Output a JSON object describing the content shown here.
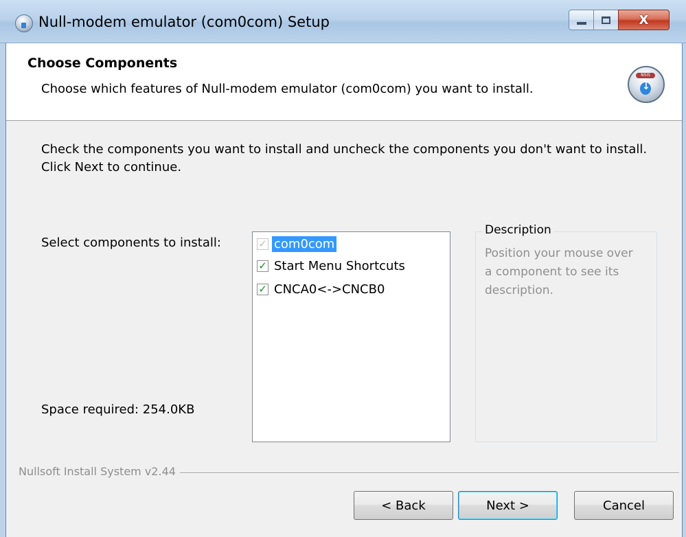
{
  "window": {
    "title": "Null-modem emulator (com0com) Setup",
    "controls": {
      "minimize": "minimize",
      "maximize": "maximize",
      "close": "X"
    }
  },
  "header": {
    "title": "Choose Components",
    "subtitle": "Choose which features of Null-modem emulator (com0com) you want to install.",
    "icon": "installer-disc-icon",
    "icon_badge": "NSIS"
  },
  "main": {
    "instruction": "Check the components you want to install and uncheck the components you don't want to install. Click Next to continue.",
    "select_label": "Select components to install:",
    "space_required": "Space required: 254.0KB",
    "components": [
      {
        "label": "com0com",
        "checked": true,
        "disabled": true,
        "selected": true
      },
      {
        "label": "Start Menu Shortcuts",
        "checked": true,
        "disabled": false,
        "selected": false
      },
      {
        "label": "CNCA0<->CNCB0",
        "checked": true,
        "disabled": false,
        "selected": false
      }
    ],
    "description": {
      "title": "Description",
      "text": "Position your mouse over a component to see its description."
    }
  },
  "footer": {
    "branding": "Nullsoft Install System v2.44",
    "back_label": "< Back",
    "next_label": "Next >",
    "cancel_label": "Cancel"
  },
  "colors": {
    "selection": "#3399ff",
    "check": "#1f8a2a",
    "close_button": "#c2391f"
  }
}
